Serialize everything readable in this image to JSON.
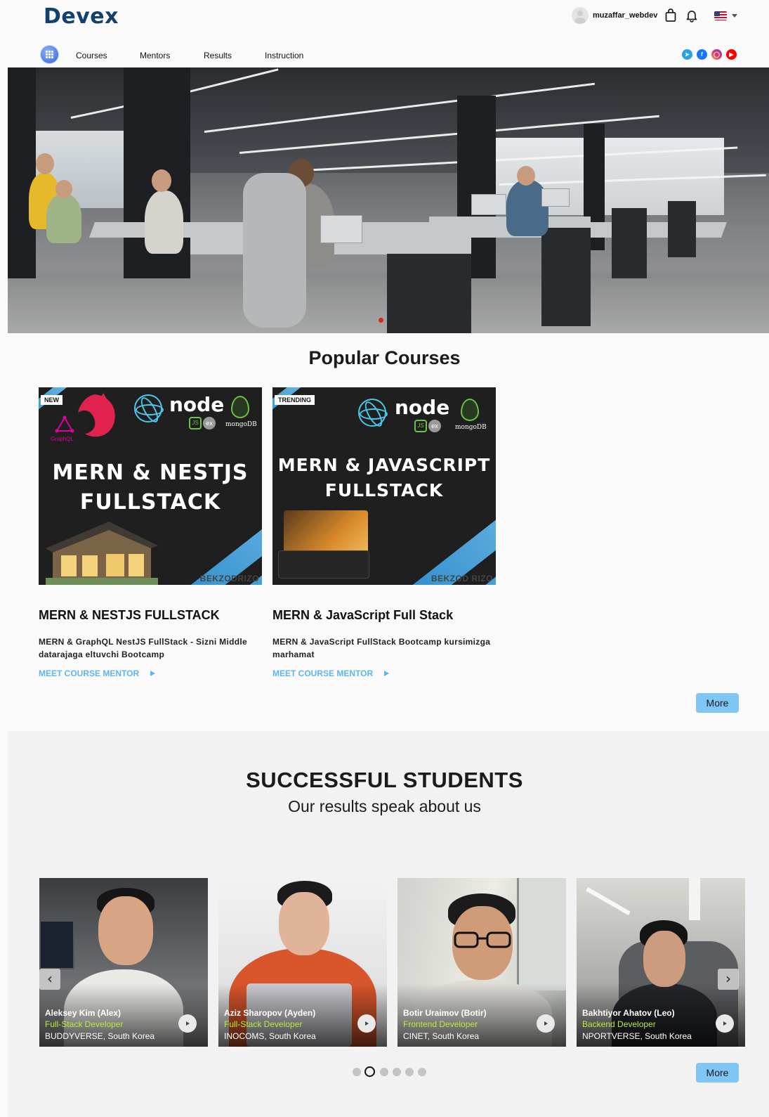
{
  "header": {
    "logo": "Devex",
    "username": "muzaffar_webdev"
  },
  "nav": {
    "items": [
      {
        "label": "Courses"
      },
      {
        "label": "Mentors"
      },
      {
        "label": "Results"
      },
      {
        "label": "Instruction"
      }
    ],
    "social": [
      "telegram-icon",
      "facebook-icon",
      "instagram-icon",
      "youtube-icon"
    ]
  },
  "hero": {
    "active_slide": 1
  },
  "popular": {
    "title": "Popular Courses",
    "courses": [
      {
        "tag": "NEW",
        "image_title_line1": "MERN & NESTJS",
        "image_title_line2": "FULLSTACK",
        "image_author": "BEKZODRIZO",
        "name": "MERN & NESTJS FULLSTACK",
        "description": "MERN & GraphQL NestJS FullStack - Sizni Middle datarajaga eltuvchi Bootcamp",
        "link": "MEET COURSE MENTOR"
      },
      {
        "tag": "TRENDING",
        "image_title_line1": "MERN & JAVASCRIPT",
        "image_title_line2": "FULLSTACK",
        "image_author": "BEKZOD RIZO",
        "name": "MERN & JavaScript Full Stack",
        "description": "MERN & JavaScript FullStack Bootcamp kursimizga marhamat",
        "link": "MEET COURSE MENTOR"
      }
    ],
    "logo_text": {
      "graphql": "GraphQL",
      "node": "node",
      "js": "JS",
      "ex": "ex",
      "mongo": "mongoDB"
    },
    "more": "More"
  },
  "students": {
    "title": "SUCCESSFUL STUDENTS",
    "subtitle": "Our results speak about us",
    "items": [
      {
        "name": "Aleksey Kim (Alex)",
        "role": "Full-Stack Developer",
        "company": "BUDDYVERSE, South Korea"
      },
      {
        "name": "Aziz Sharopov (Ayden)",
        "role": "Full-Stack Developer",
        "company": "INOCOMS, South Korea"
      },
      {
        "name": "Botir Uraimov (Botir)",
        "role": "Frontend Developer",
        "company": "CINET, South Korea"
      },
      {
        "name": "Bakhtiyor Ahatov (Leo)",
        "role": "Backend Developer",
        "company": "NPORTVERSE, South Korea"
      }
    ],
    "pagination": {
      "total": 6,
      "active": 2
    },
    "more": "More"
  },
  "colors": {
    "brand": "#14406e",
    "accent": "#7fc6f2",
    "link": "#61b4ef",
    "role": "#b4ee38"
  }
}
